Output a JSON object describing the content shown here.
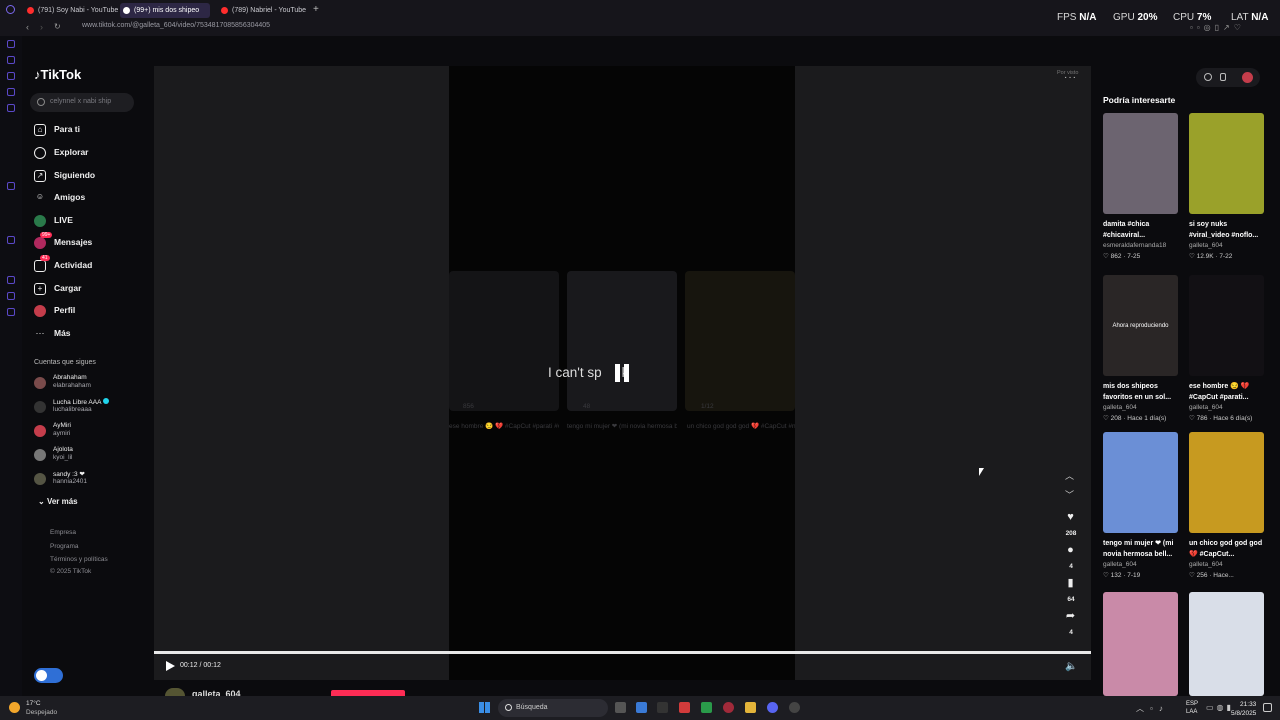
{
  "browser": {
    "tabs": [
      {
        "label": "(791) Soy Nabi - YouTube"
      },
      {
        "label": "(99+) mis dos shipeo"
      },
      {
        "label": "(789) Nabriel - YouTube"
      }
    ],
    "new_tab": "+",
    "url": "www.tiktok.com/@galleta_604/video/7534817085856304405"
  },
  "overlay_stats": {
    "fps_label": "FPS",
    "fps_value": "N/A",
    "gpu_label": "GPU",
    "gpu_value": "20",
    "cpu_label": "CPU",
    "cpu_value": "7",
    "lat_label": "LAT",
    "lat_value": "N/A",
    "percent": "%"
  },
  "tiktok": {
    "logo": "TikTok",
    "search_placeholder": "celynnel x nabi ship",
    "nav": [
      {
        "label": "Para ti",
        "icon": "home-icon"
      },
      {
        "label": "Explorar",
        "icon": "compass-icon"
      },
      {
        "label": "Siguiendo",
        "icon": "following-icon"
      },
      {
        "label": "Amigos",
        "icon": "friends-icon"
      },
      {
        "label": "LIVE",
        "icon": "live-icon"
      },
      {
        "label": "Mensajes",
        "icon": "messages-icon",
        "badge": "99+"
      },
      {
        "label": "Actividad",
        "icon": "activity-icon",
        "badge": "41"
      },
      {
        "label": "Cargar",
        "icon": "upload-icon"
      },
      {
        "label": "Perfil",
        "icon": "profile-icon"
      },
      {
        "label": "Más",
        "icon": "more-icon"
      }
    ],
    "following_heading": "Cuentas que sigues",
    "following": [
      {
        "name": "Abrahaham",
        "handle": "elabrahaham"
      },
      {
        "name": "Lucha Libre AAA",
        "handle": "luchalibreaaa",
        "verified": true
      },
      {
        "name": "AyMiri",
        "handle": "aymiri"
      },
      {
        "name": "Ajolota",
        "handle": "kyoi_lil"
      },
      {
        "name": "sandy :3 ❤",
        "handle": "hannia2401"
      }
    ],
    "see_more": "Ver más",
    "footer": [
      "Empresa",
      "Programa",
      "Términos y políticas",
      "© 2025 TikTok"
    ]
  },
  "player": {
    "subtitle": "I can't sp",
    "subtitle_tail": "k",
    "time": "00:12 / 00:12",
    "progress_fraction": 1.0,
    "report_label": "Por visto",
    "more": "···",
    "ghost_captions": [
      "ese hombre 😏 💔 #CapCut #parati #viral_vid...",
      "tengo mi mujer ❤ (mi novia hermosa bella chula) #para...",
      "un chico god god god 💔 #CapCut #nada #viral vide..."
    ],
    "ghost_counts": [
      "856",
      "48",
      "1/12"
    ],
    "likes": "208",
    "comments": "4",
    "saves": "64",
    "shares": "4",
    "author": "galleta_604"
  },
  "recommendations": {
    "heading": "Podría interesarte",
    "items": [
      {
        "title": "damita #chica #chicaviral...",
        "user": "esmeraldafernanda18",
        "likes": "862",
        "date": "7-25",
        "thumb_color": "#6c6470"
      },
      {
        "title": "si soy nuks #viral_video #noflo...",
        "user": "galleta_604",
        "likes": "12.9K",
        "date": "7-22",
        "thumb_color": "#9aa12a"
      },
      {
        "title": "mis dos shipeos favoritos en un sol...",
        "user": "galleta_604",
        "likes": "208",
        "date": "Hace 1 día(s)",
        "thumb_color": "#2a2626",
        "now_playing": "Ahora reproduciendo"
      },
      {
        "title": "ese hombre 😏 💔 #CapCut #parati...",
        "user": "galleta_604",
        "likes": "786",
        "date": "Hace 6 día(s)",
        "thumb_color": "#121014"
      },
      {
        "title": "tengo mi mujer ❤ (mi novia hermosa bell...",
        "user": "galleta_604",
        "likes": "132",
        "date": "7-19",
        "thumb_color": "#6b8fd6"
      },
      {
        "title": "un chico god god god 💔 #CapCut...",
        "user": "galleta_604",
        "likes": "256",
        "date": "Hace...",
        "thumb_color": "#c79a20"
      },
      {
        "title": "",
        "user": "",
        "likes": "",
        "date": "",
        "thumb_color": "#c98aa8"
      },
      {
        "title": "",
        "user": "",
        "likes": "",
        "date": "",
        "thumb_color": "#d9dee8"
      }
    ]
  },
  "taskbar": {
    "weather_temp": "17°C",
    "weather_desc": "Despejado",
    "search": "Búsqueda",
    "lang1": "ESP",
    "lang2": "LAA",
    "time": "21:33",
    "date": "5/8/2025"
  },
  "colors": {
    "accent": "#fe2c55",
    "tab_active": "#2d2745",
    "win_blue": "#3a8ee6"
  }
}
